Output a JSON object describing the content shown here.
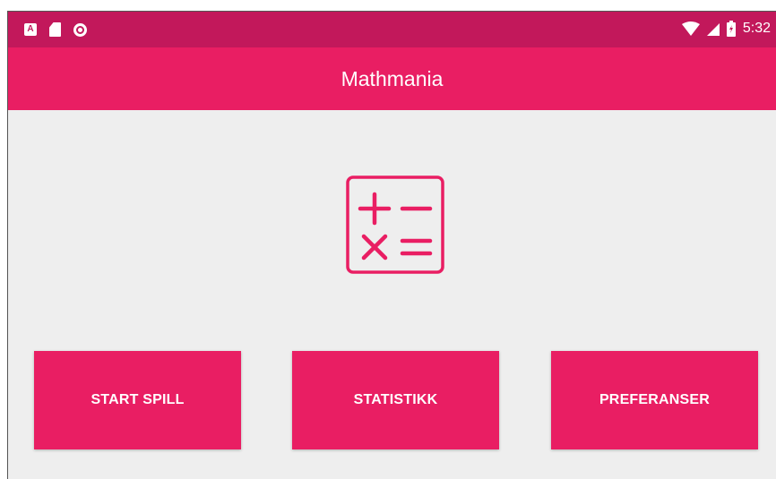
{
  "status_bar": {
    "left_icons": [
      "notification-a-icon",
      "sd-card-icon",
      "sync-circle-icon"
    ],
    "right_icons": [
      "wifi-icon",
      "cell-signal-icon",
      "battery-icon"
    ],
    "time": "5:32",
    "color": "#c2185b"
  },
  "app_bar": {
    "title": "Mathmania",
    "color": "#e91e63"
  },
  "main": {
    "logo_icon": "math-operators-icon",
    "background": "#eeeeee",
    "buttons": {
      "start": "START SPILL",
      "stats": "STATISTIKK",
      "prefs": "PREFERANSER"
    }
  },
  "colors": {
    "accent": "#e91e63",
    "dark_accent": "#c2185b",
    "text_on_accent": "#ffffff"
  }
}
